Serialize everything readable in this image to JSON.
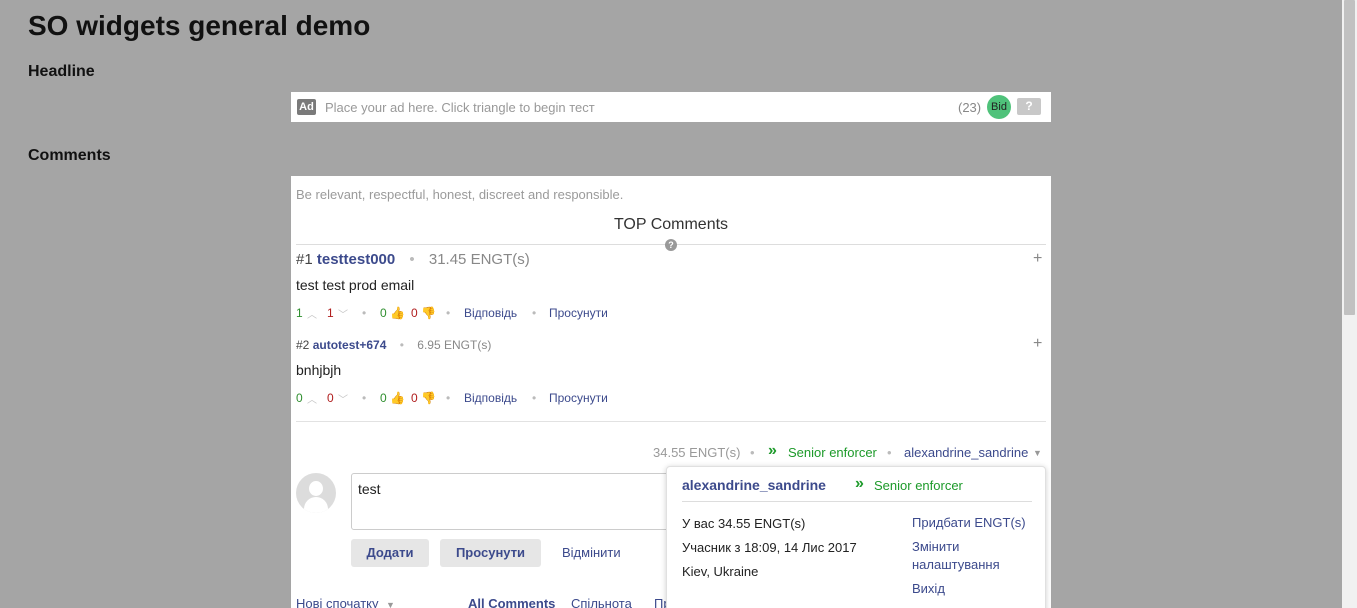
{
  "page": {
    "title": "SO widgets general demo"
  },
  "sections": {
    "headline": "Headline",
    "comments": "Comments"
  },
  "ad": {
    "badge": "Ad",
    "text": "Place your ad here. Click triangle to begin тест",
    "count": "(23)",
    "bid_label": "Bid",
    "help_label": "?"
  },
  "comments_widget": {
    "rules": "Be relevant, respectful, honest, discreet and responsible.",
    "top_title": "TOP Comments",
    "top_help": "?",
    "comments": [
      {
        "rank": "#1",
        "author": "testtest000",
        "score": "31.45 ENGT(s)",
        "body": "test test prod email",
        "up_votes": "1",
        "down_votes": "1",
        "likes": "0",
        "dislikes": "0",
        "reply": "Відповідь",
        "promote": "Просунути"
      },
      {
        "rank": "#2",
        "author": "autotest+674",
        "score": "6.95 ENGT(s)",
        "body": "bnhjbjh",
        "up_votes": "0",
        "down_votes": "0",
        "likes": "0",
        "dislikes": "0",
        "reply": "Відповідь",
        "promote": "Просунути"
      }
    ],
    "current_user": {
      "balance": "34.55 ENGT(s)",
      "rank": "Senior enforcer",
      "username": "alexandrine_sandrine"
    },
    "compose": {
      "text": "test",
      "add_label": "Додати",
      "promote_label": "Просунути",
      "cancel_label": "Відмінити"
    },
    "sort": {
      "order": "Нові спочатку",
      "tabs": [
        "All Comments",
        "Спільнота",
        "Пр"
      ]
    }
  },
  "user_popup": {
    "username": "alexandrine_sandrine",
    "rank": "Senior enforcer",
    "balance_text": "У вас 34.55 ENGT(s)",
    "member_since": "Учасник з 18:09, 14 Лис 2017",
    "location": "Kiev, Ukraine",
    "links": [
      "Придбати ENGT(s)",
      "Змінити налаштування",
      "Вихід"
    ]
  },
  "colors": {
    "background": "#a5a5a5",
    "link": "#3c4a8c",
    "positive": "#2f8f2f",
    "negative": "#b01d1d",
    "rank": "#1d9a2a",
    "bid": "#4fc27a"
  }
}
